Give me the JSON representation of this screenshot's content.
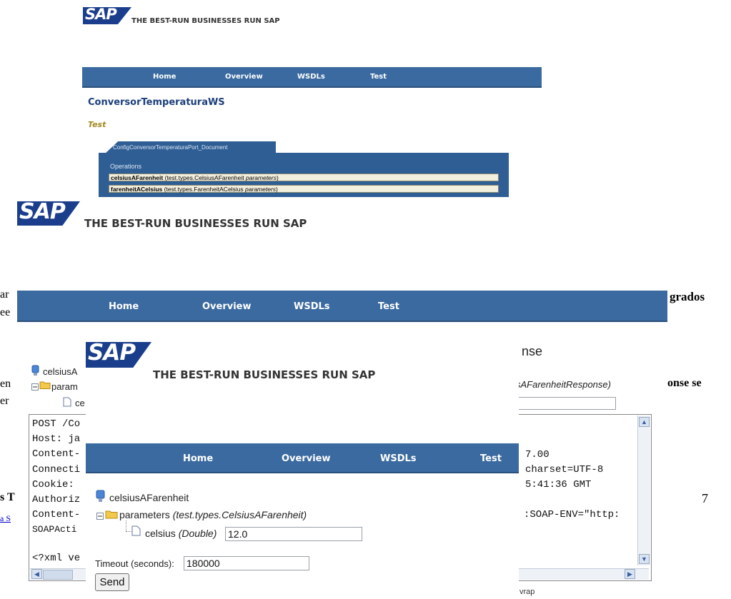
{
  "brand": {
    "logo_text": "SAP",
    "tagline": "THE BEST-RUN BUSINESSES RUN SAP"
  },
  "nav": {
    "home": "Home",
    "overview": "Overview",
    "wsdls": "WSDLs",
    "test": "Test"
  },
  "screen1": {
    "service_title": "ConversorTemperaturaWS",
    "section_label": "Test",
    "port_tab": "ConfigConversorTemperaturaPort_Document",
    "operations_header": "Operations",
    "operations": [
      {
        "name": "celsiusAFarenheit",
        "signature": "(test.types.CelsiusAFarenheit ",
        "param": "parameters",
        "close": ")"
      },
      {
        "name": "farenheitACelsius",
        "signature": "(test.types.FarenheitACelsius ",
        "param": "parameters",
        "close": ")"
      }
    ]
  },
  "screen2": {
    "response_label": "nse",
    "response_type": "sAFarenheitResponse)",
    "partial_tree_root": "celsiusA",
    "partial_tree_param": "param",
    "partial_tree_leaf": "ce",
    "request_lines": [
      "POST /Co",
      "Host: ja",
      "Content-",
      "Connecti",
      "Cookie:",
      "Authoriz",
      "Content-",
      "SOAPActi",
      "",
      "<?xml ve"
    ],
    "response_lines": [
      "7.00",
      "charset=UTF-8",
      "5:41:36 GMT",
      "",
      ":SOAP-ENV=\"http:"
    ],
    "wrap_label": "vrap"
  },
  "screen3": {
    "operation": "celsiusAFarenheit",
    "parameters_label": "parameters",
    "parameters_type": "(test.types.CelsiusAFarenheit)",
    "field_name": "celsius",
    "field_type": "(Double)",
    "field_value": "12.0",
    "timeout_label": "Timeout (seconds):",
    "timeout_value": "180000",
    "send_label": "Send"
  },
  "document": {
    "left_fragments": [
      "ar",
      "ee",
      "en",
      "er",
      "s T",
      "a S"
    ],
    "right_fragments": [
      "grados",
      "onse se"
    ],
    "page_number": "7"
  }
}
